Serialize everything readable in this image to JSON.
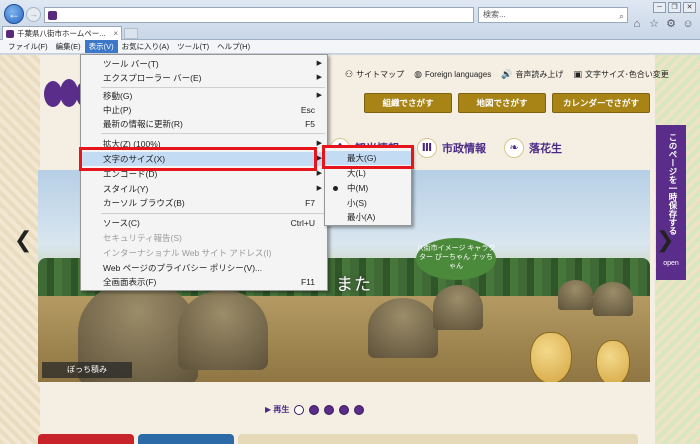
{
  "browser": {
    "tab_title": "千葉県八街市ホームペー...",
    "search_placeholder": "検索...",
    "back_glyph": "←",
    "forward_glyph": "→",
    "win_minimize": "─",
    "win_restore": "❐",
    "win_close": "✕"
  },
  "menubar": [
    {
      "label": "ファイル(F)"
    },
    {
      "label": "編集(E)"
    },
    {
      "label": "表示(V)",
      "active": true
    },
    {
      "label": "お気に入り(A)"
    },
    {
      "label": "ツール(T)"
    },
    {
      "label": "ヘルプ(H)"
    }
  ],
  "view_menu": {
    "items": [
      {
        "label": "ツール バー(T)",
        "submenu": true
      },
      {
        "label": "エクスプローラー バー(E)",
        "submenu": true
      },
      {
        "label": "移動(G)",
        "submenu": true
      },
      {
        "label": "中止(P)",
        "shortcut": "Esc"
      },
      {
        "label": "最新の情報に更新(R)",
        "shortcut": "F5"
      },
      {
        "label": "拡大(Z) (100%)",
        "submenu": true
      },
      {
        "label": "文字のサイズ(X)",
        "submenu": true,
        "hover": true
      },
      {
        "label": "エンコード(D)",
        "submenu": true
      },
      {
        "label": "スタイル(Y)",
        "submenu": true
      },
      {
        "label": "カーソル ブラウズ(B)",
        "shortcut": "F7"
      },
      {
        "label": "ソース(C)",
        "shortcut": "Ctrl+U"
      },
      {
        "label": "セキュリティ報告(S)",
        "disabled": true
      },
      {
        "label": "インターナショナル Web サイト アドレス(I)",
        "disabled": true
      },
      {
        "label": "Web ページのプライバシー ポリシー(V)..."
      },
      {
        "label": "全画面表示(F)",
        "shortcut": "F11"
      }
    ]
  },
  "text_size_menu": {
    "items": [
      {
        "label": "最大(G)",
        "hover": true
      },
      {
        "label": "大(L)"
      },
      {
        "label": "中(M)",
        "selected": true
      },
      {
        "label": "小(S)"
      },
      {
        "label": "最小(A)"
      }
    ]
  },
  "site": {
    "utility_links": [
      {
        "icon": "sitemap-icon",
        "glyph": "⚇",
        "label": "サイトマップ"
      },
      {
        "icon": "globe-icon",
        "glyph": "◍",
        "label": "Foreign languages"
      },
      {
        "icon": "speaker-icon",
        "glyph": "🔊",
        "label": "音声読み上げ"
      },
      {
        "icon": "text-size-icon",
        "glyph": "▣",
        "label": "文字サイズ･色合い変更"
      }
    ],
    "buttons": [
      {
        "label": "組織でさがす"
      },
      {
        "label": "地図でさがす"
      },
      {
        "label": "カレンダーでさがす"
      }
    ],
    "categories": [
      {
        "icon": "sightseeing-icon",
        "glyph": "✿",
        "label": "観光情報"
      },
      {
        "icon": "city-hall-icon",
        "glyph": "Ⅲ",
        "label": "市政情報"
      },
      {
        "icon": "peanut-icon",
        "glyph": "❧",
        "label": "落花生"
      }
    ],
    "hero_text": "また",
    "hero_caption": "ぼっち積み",
    "mascot_badge": "八街市イメージ キャラクター ぴーちゃん ナッちゃん",
    "play_label": "▶ 再生",
    "side_tab_label": "このページを一時保存する",
    "side_tab_open": "open",
    "colors": {
      "accent": "#5b2d8a",
      "gold": "#a88417",
      "highlight": "#e8141b"
    }
  }
}
